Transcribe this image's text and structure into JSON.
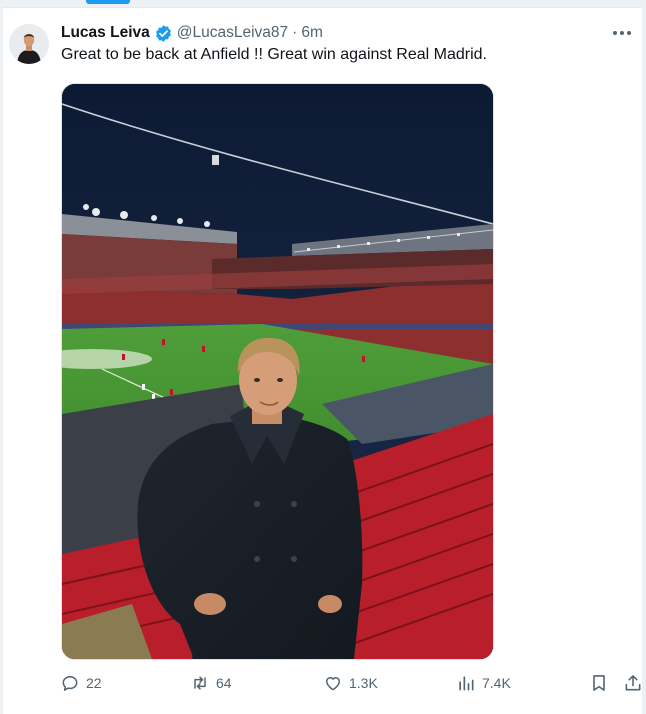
{
  "tweet": {
    "author_name": "Lucas Leiva",
    "handle": "@LucasLeiva87",
    "separator": "·",
    "time": "6m",
    "text": "Great to be back at Anfield !! Great win against Real Madrid.",
    "verified_color": "#1d9bf0"
  },
  "icons": {
    "verified": "verified-badge-icon",
    "more": "more-dots-icon",
    "reply": "reply-icon",
    "retweet": "retweet-icon",
    "like": "heart-icon",
    "views": "views-bar-chart-icon",
    "bookmark": "bookmark-icon",
    "share": "share-icon"
  },
  "actions": {
    "replies": "22",
    "retweets": "64",
    "likes": "1.3K",
    "views": "7.4K"
  },
  "colors": {
    "text": "#0f1419",
    "secondary": "#536471",
    "accent": "#1d9bf0"
  }
}
